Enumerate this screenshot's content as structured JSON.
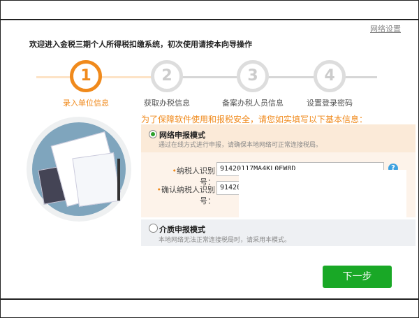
{
  "header": {
    "network_settings": "网络设置",
    "welcome": "欢迎进入金税三期个人所得税扣缴系统，初次使用请按本向导操作"
  },
  "steps": [
    {
      "num": "1",
      "label": "录入单位信息",
      "active": true
    },
    {
      "num": "2",
      "label": "获取办税信息"
    },
    {
      "num": "3",
      "label": "备案办税人员信息"
    },
    {
      "num": "4",
      "label": "设置登录密码"
    }
  ],
  "form": {
    "notice": "为了保障软件使用和报税安全，请您如实填写以下基本信息：",
    "online_mode": {
      "label": "网络申报模式",
      "desc": "通过在线方式进行申报，请确保本地网络可正常连接税局。",
      "selected": true
    },
    "taxpayer_id_label": "纳税人识别号：",
    "taxpayer_id_value": "91420117MA4KL0EW8D",
    "confirm_id_label": "确认纳税人识别号：",
    "confirm_id_value": "914201",
    "help": "?",
    "required": "•",
    "media_mode": {
      "label": "介质申报模式",
      "desc": "本地网络无法正常连接税局时，请采用本模式。",
      "selected": false
    }
  },
  "next_button": "下一步"
}
